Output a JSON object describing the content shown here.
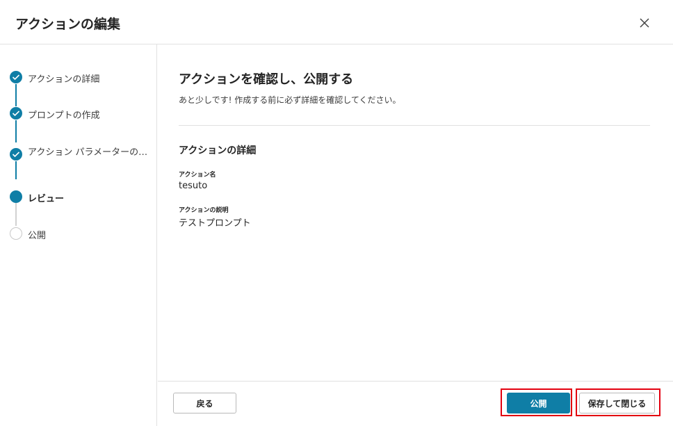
{
  "dialog": {
    "title": "アクションの編集"
  },
  "steps": [
    {
      "label": "アクションの詳細",
      "state": "done"
    },
    {
      "label": "プロンプトの作成",
      "state": "done"
    },
    {
      "label": "アクション パラメーターの…",
      "state": "done"
    },
    {
      "label": "レビュー",
      "state": "current"
    },
    {
      "label": "公開",
      "state": "todo"
    }
  ],
  "main": {
    "heading": "アクションを確認し、公開する",
    "subtitle": "あと少しです! 作成する前に必ず詳細を確認してください。",
    "section_title": "アクションの詳細",
    "fields": [
      {
        "label": "アクション名",
        "value": "tesuto"
      },
      {
        "label": "アクションの説明",
        "value": "テストプロンプト"
      }
    ]
  },
  "footer": {
    "back_label": "戻る",
    "publish_label": "公開",
    "save_close_label": "保存して閉じる"
  },
  "colors": {
    "accent": "#0f7ea6",
    "highlight": "#e3000f"
  }
}
